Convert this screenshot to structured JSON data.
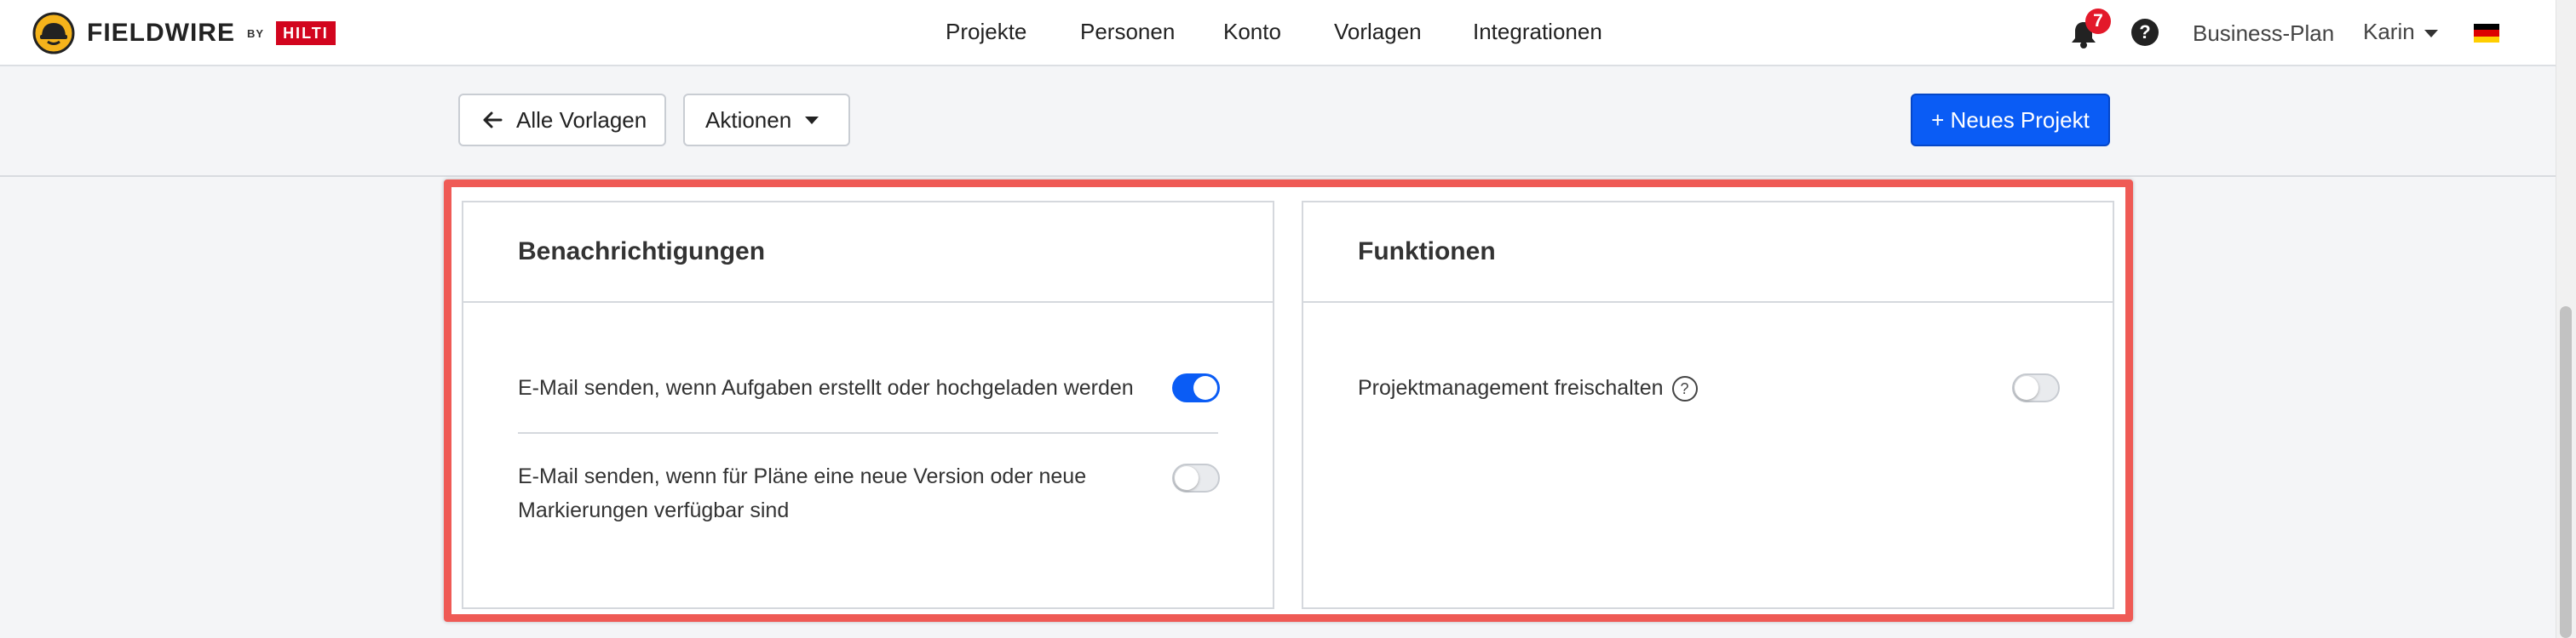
{
  "brand": {
    "name": "FIELDWIRE",
    "by": "BY",
    "partner": "HILTI"
  },
  "nav": {
    "items": [
      "Projekte",
      "Personen",
      "Konto",
      "Vorlagen",
      "Integrationen"
    ]
  },
  "header": {
    "notification_count": "7",
    "help_symbol": "?",
    "plan": "Business-Plan",
    "user": "Karin",
    "language_flag": "german-flag-icon"
  },
  "toolbar": {
    "back_label": "Alle Vorlagen",
    "actions_label": "Aktionen",
    "new_project_label": "+ Neues Projekt"
  },
  "colors": {
    "primary": "#0a5cf5",
    "highlight_border": "#ef5a55",
    "badge": "#e3192a"
  },
  "notifications": {
    "title": "Benachrichtigungen",
    "items": [
      {
        "label": "E-Mail senden, wenn Aufgaben erstellt oder hochgeladen werden",
        "enabled": true
      },
      {
        "label_line1": "E-Mail senden, wenn für Pläne eine neue Version oder neue",
        "label_line2": "Markierungen verfügbar sind",
        "enabled": false
      }
    ]
  },
  "features": {
    "title": "Funktionen",
    "items": [
      {
        "label": "Projektmanagement freischalten",
        "help": "?",
        "enabled": false
      }
    ]
  }
}
